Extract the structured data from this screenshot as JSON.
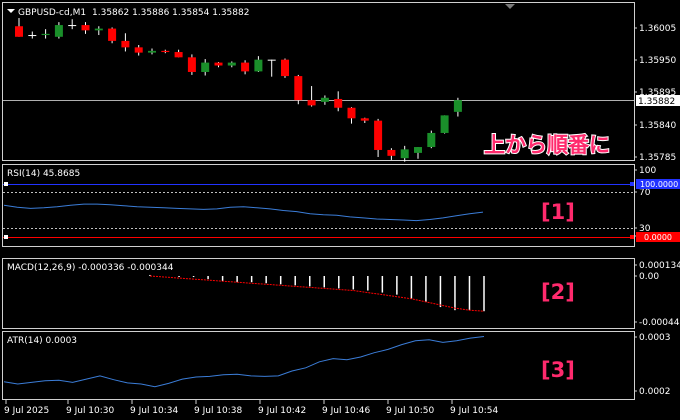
{
  "colors": {
    "background": "#000000",
    "frame": "#d0d0d0",
    "bull": "#1a8f2a",
    "bear": "#ff0000",
    "doji": "#ffffff",
    "rsi_line": "#3b7dd8",
    "atr_line": "#3b7dd8",
    "macd_signal": "#ff0000",
    "macd_hist": "#ffffff",
    "annotation": "#ff2a6d",
    "rsi_upper": "#2233ff",
    "rsi_lower": "#ff0000"
  },
  "header": {
    "symbol": "GBPUSD-cd,M1",
    "ohlc": "1.35862 1.35886 1.35854 1.35882"
  },
  "annotation": {
    "text": "上から順番に"
  },
  "main_axis": {
    "ticks": [
      "1.36005",
      "1.35950",
      "1.35895",
      "1.35840",
      "1.35785"
    ],
    "price_label": "1.35882"
  },
  "rsi": {
    "label": "RSI(14) 45.8685",
    "marker": "[1]",
    "ticks": [
      "100",
      "70",
      "30",
      "0"
    ],
    "upper_tag": "100.0000",
    "lower_tag": "0.0000"
  },
  "macd": {
    "label": "MACD(12,26,9) -0.000336 -0.000344",
    "marker": "[2]",
    "ticks": [
      "0.000134",
      "0.00",
      "-0.000444"
    ]
  },
  "atr": {
    "label": "ATR(14) 0.0003",
    "marker": "[3]",
    "ticks": [
      "0.0003",
      "0.0002"
    ]
  },
  "time_axis": [
    "9 Jul 2025",
    "9 Jul 10:30",
    "9 Jul 10:34",
    "9 Jul 10:38",
    "9 Jul 10:42",
    "9 Jul 10:46",
    "9 Jul 10:50",
    "9 Jul 10:54"
  ],
  "chart_data": [
    {
      "type": "candlestick",
      "symbol": "GBPUSD-cd,M1",
      "y_axis_ticks": [
        1.36005,
        1.3595,
        1.35895,
        1.3584,
        1.35785
      ],
      "current_price": 1.35882,
      "candles": [
        {
          "o": 1.36008,
          "h": 1.36022,
          "l": 1.3599,
          "c": 1.3599
        },
        {
          "o": 1.35993,
          "h": 1.35999,
          "l": 1.35987,
          "c": 1.35993
        },
        {
          "o": 1.35993,
          "h": 1.36003,
          "l": 1.35987,
          "c": 1.35995
        },
        {
          "o": 1.3599,
          "h": 1.36015,
          "l": 1.35987,
          "c": 1.3601
        },
        {
          "o": 1.3601,
          "h": 1.3602,
          "l": 1.36003,
          "c": 1.3601
        },
        {
          "o": 1.3601,
          "h": 1.36015,
          "l": 1.35995,
          "c": 1.36001
        },
        {
          "o": 1.36001,
          "h": 1.36008,
          "l": 1.35993,
          "c": 1.36004
        },
        {
          "o": 1.36004,
          "h": 1.36006,
          "l": 1.35979,
          "c": 1.35983
        },
        {
          "o": 1.35983,
          "h": 1.35996,
          "l": 1.35965,
          "c": 1.35972
        },
        {
          "o": 1.35972,
          "h": 1.35976,
          "l": 1.35958,
          "c": 1.35963
        },
        {
          "o": 1.35963,
          "h": 1.3597,
          "l": 1.3596,
          "c": 1.35966
        },
        {
          "o": 1.35966,
          "h": 1.35968,
          "l": 1.35962,
          "c": 1.35964
        },
        {
          "o": 1.35964,
          "h": 1.35968,
          "l": 1.35955,
          "c": 1.35955
        },
        {
          "o": 1.35955,
          "h": 1.3596,
          "l": 1.35925,
          "c": 1.3593
        },
        {
          "o": 1.3593,
          "h": 1.35952,
          "l": 1.35924,
          "c": 1.35946
        },
        {
          "o": 1.35946,
          "h": 1.35947,
          "l": 1.35938,
          "c": 1.35941
        },
        {
          "o": 1.35941,
          "h": 1.35948,
          "l": 1.35938,
          "c": 1.35946
        },
        {
          "o": 1.35946,
          "h": 1.3595,
          "l": 1.35926,
          "c": 1.35931
        },
        {
          "o": 1.35931,
          "h": 1.35957,
          "l": 1.3593,
          "c": 1.35951
        },
        {
          "o": 1.35951,
          "h": 1.35951,
          "l": 1.35922,
          "c": 1.35951
        },
        {
          "o": 1.35951,
          "h": 1.35953,
          "l": 1.3592,
          "c": 1.35923
        },
        {
          "o": 1.35923,
          "h": 1.35925,
          "l": 1.35875,
          "c": 1.35882
        },
        {
          "o": 1.35882,
          "h": 1.35906,
          "l": 1.35871,
          "c": 1.35873
        },
        {
          "o": 1.35879,
          "h": 1.3589,
          "l": 1.35874,
          "c": 1.35886
        },
        {
          "o": 1.35884,
          "h": 1.35897,
          "l": 1.35863,
          "c": 1.35869
        },
        {
          "o": 1.35869,
          "h": 1.3587,
          "l": 1.35842,
          "c": 1.35851
        },
        {
          "o": 1.35851,
          "h": 1.35852,
          "l": 1.35843,
          "c": 1.35847
        },
        {
          "o": 1.35847,
          "h": 1.3585,
          "l": 1.35785,
          "c": 1.35797
        },
        {
          "o": 1.35797,
          "h": 1.358,
          "l": 1.3578,
          "c": 1.35787
        },
        {
          "o": 1.35783,
          "h": 1.35804,
          "l": 1.35777,
          "c": 1.35798
        },
        {
          "o": 1.35792,
          "h": 1.35802,
          "l": 1.35782,
          "c": 1.35802
        },
        {
          "o": 1.35802,
          "h": 1.3583,
          "l": 1.358,
          "c": 1.35826
        },
        {
          "o": 1.35826,
          "h": 1.35856,
          "l": 1.35825,
          "c": 1.35856
        },
        {
          "o": 1.35862,
          "h": 1.35886,
          "l": 1.35854,
          "c": 1.35882
        }
      ]
    },
    {
      "type": "line",
      "name": "RSI(14)",
      "y_axis_ticks": [
        100,
        70,
        30,
        0
      ],
      "levels": [
        70,
        30
      ],
      "values": [
        60,
        56,
        54,
        55,
        57,
        60,
        62,
        62,
        61,
        59,
        57,
        56,
        55,
        54,
        53,
        52,
        53,
        56,
        57,
        55,
        53,
        50,
        48,
        44,
        42,
        41,
        38,
        36,
        34,
        33,
        32,
        31,
        33,
        36,
        40,
        44,
        47
      ]
    },
    {
      "type": "bar+line",
      "name": "MACD(12,26,9)",
      "y_axis_ticks": [
        0.000134,
        0.0,
        -0.000444
      ],
      "histogram": [
        1e-05,
        0.0,
        -1e-05,
        -1e-05,
        -3e-05,
        -5e-05,
        -6e-05,
        -6e-05,
        -7e-05,
        -8e-05,
        -9e-05,
        -0.0001,
        -0.00011,
        -0.00012,
        -0.00013,
        -0.00014,
        -0.00016,
        -0.00018,
        -0.00022,
        -0.00025,
        -0.0003,
        -0.00033,
        -0.00033,
        -0.00034
      ],
      "signal": [
        0.0,
        -1e-05,
        -2e-05,
        -3e-05,
        -4e-05,
        -5e-05,
        -6e-05,
        -7e-05,
        -8e-05,
        -9e-05,
        -0.0001,
        -0.00011,
        -0.00012,
        -0.00013,
        -0.00014,
        -0.00016,
        -0.00018,
        -0.0002,
        -0.00022,
        -0.00025,
        -0.00028,
        -0.00031,
        -0.00033,
        -0.00034
      ]
    },
    {
      "type": "line",
      "name": "ATR(14)",
      "y_axis_ticks": [
        0.0003,
        0.0002
      ],
      "values": [
        0.000217,
        0.000213,
        0.000216,
        0.000219,
        0.00022,
        0.000216,
        0.000222,
        0.000228,
        0.000221,
        0.000215,
        0.000213,
        0.000208,
        0.000214,
        0.000222,
        0.000226,
        0.000227,
        0.00023,
        0.000231,
        0.000228,
        0.000227,
        0.000228,
        0.000237,
        0.000243,
        0.000254,
        0.00026,
        0.000258,
        0.000263,
        0.000271,
        0.000277,
        0.000286,
        0.000293,
        0.000295,
        0.00029,
        0.000293,
        0.000298,
        0.000301
      ]
    }
  ]
}
